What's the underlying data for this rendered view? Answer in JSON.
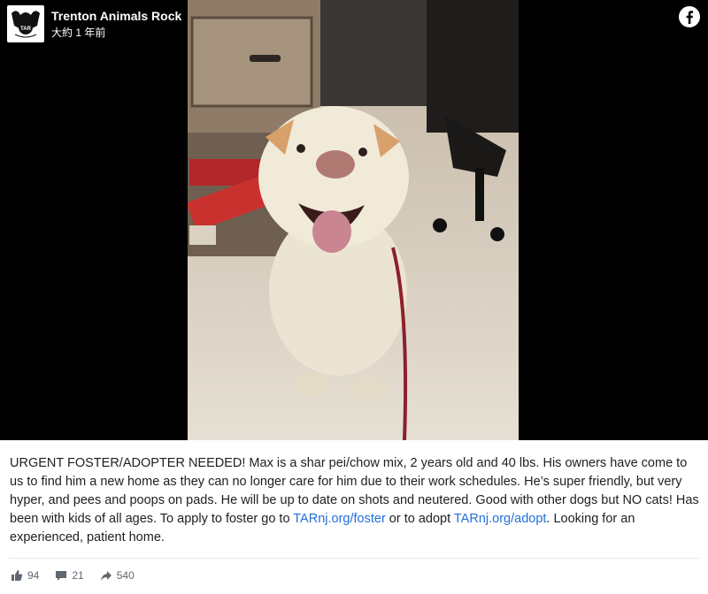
{
  "post": {
    "page_name": "Trenton Animals Rock",
    "timestamp": "大約 1 年前",
    "avatar_icon": "tar-logo-icon",
    "avatar_text": "TAR",
    "platform_icon": "facebook-logo-icon",
    "caption": {
      "part1": "URGENT FOSTER/ADOPTER NEEDED! Max is a shar pei/chow mix, 2 years old and 40 lbs. His owners have come to us to find him a new home as they can no longer care for him due to their work schedules. He’s super friendly, but very hyper, and pees and poops on pads. He will be up to date on shots and neutered. Good with other dogs but NO cats! Has been with kids of all ages. To apply to foster go to ",
      "link1": "TARnj.org/foster",
      "part2": " or to adopt ",
      "link2": "TARnj.org/adopt",
      "part3": ". Looking for an experienced, patient home."
    }
  },
  "stats": {
    "likes": "94",
    "comments": "21",
    "shares": "540"
  },
  "colors": {
    "link": "#216fdb",
    "text": "#1c1e21",
    "meta": "#606770",
    "media_bg": "#000000"
  }
}
